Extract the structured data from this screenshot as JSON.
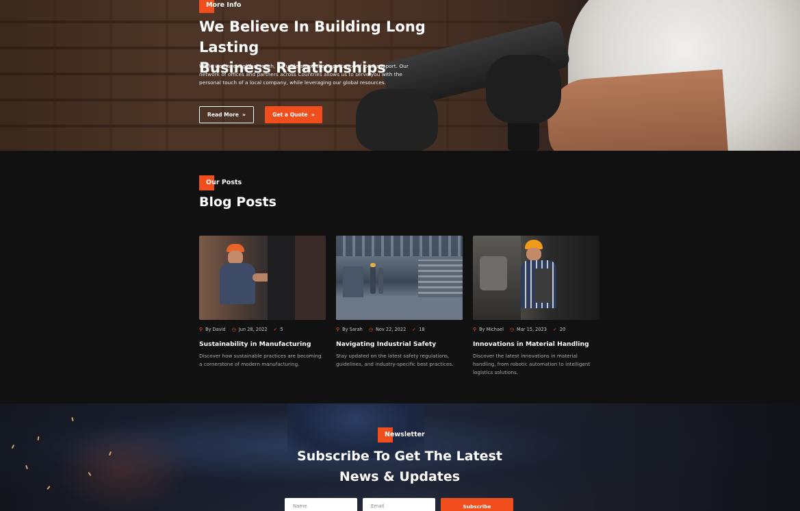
{
  "colors": {
    "accent": "#f04e1c",
    "background": "#111111",
    "text": "#ffffff",
    "muted": "#a9a9a9"
  },
  "hero": {
    "tag": "More Info",
    "title_line1": "We Believe In Building Long Lasting",
    "title_line2": "Business Relationships",
    "text": "While we have a global reach, we understand the importance of local support. Our network of offices and partners across Countries allows us to serve you with the personal touch of a local company, while leveraging our global resources.",
    "read_more": "Read More",
    "get_quote": "Get a Quote",
    "chevron_icon": "double-chevron-right-icon"
  },
  "blog": {
    "tag": "Our Posts",
    "title": "Blog Posts",
    "posts": [
      {
        "author": "By David",
        "date": "Jun 28, 2022",
        "likes": "5",
        "title": "Sustainability in Manufacturing",
        "text": "Discover how sustainable practices are becoming a cornerstone of modern manufacturing."
      },
      {
        "author": "By Sarah",
        "date": "Nov 22, 2022",
        "likes": "18",
        "title": "Navigating Industrial Safety",
        "text": "Stay updated on the latest safety regulations, guidelines, and industry-specific best practices."
      },
      {
        "author": "By Michael",
        "date": "Mar 15, 2023",
        "likes": "20",
        "title": "Innovations in Material Handling",
        "text": "Discover the latest innovations in material handling, from robotic automation to intelligent logistics solutions."
      }
    ]
  },
  "newsletter": {
    "tag": "Newsletter",
    "title_line1": "Subscribe To Get The Latest",
    "title_line2": "News & Updates",
    "name_placeholder": "Name",
    "email_placeholder": "Email",
    "subscribe": "Subscribe"
  }
}
